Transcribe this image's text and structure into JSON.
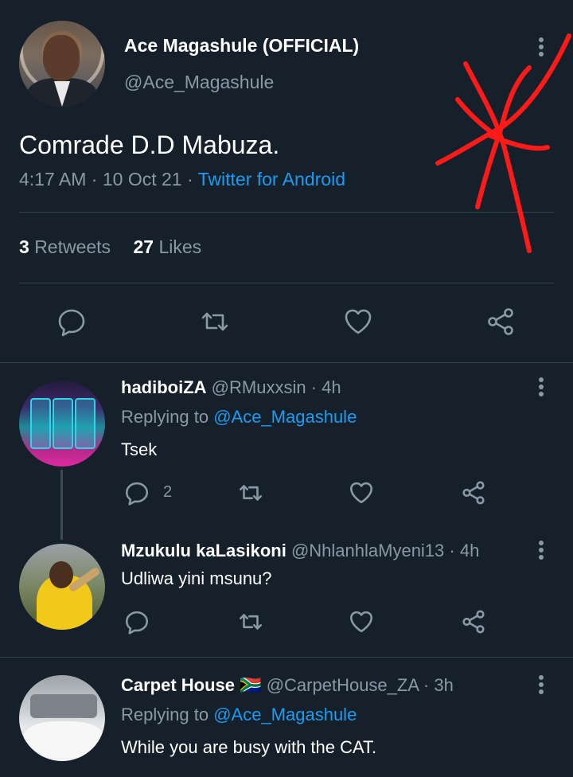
{
  "main_tweet": {
    "display_name": "Ace Magashule (OFFICIAL)",
    "handle": "@Ace_Magashule",
    "text": "Comrade D.D Mabuza.",
    "time": "4:17 AM",
    "date": "10 Oct 21",
    "source": "Twitter for Android",
    "retweets_count": "3",
    "retweets_label": "Retweets",
    "likes_count": "27",
    "likes_label": "Likes"
  },
  "replies": [
    {
      "display_name": "hadiboiZA",
      "handle": "@RMuxxsin",
      "age": "4h",
      "replying_prefix": "Replying to",
      "replying_to": "@Ace_Magashule",
      "text": "Tsek",
      "reply_count": "2"
    },
    {
      "display_name": "Mzukulu kaLasikoni",
      "handle": "@NhlanhlaMyeni13",
      "age": "4h",
      "text": "Udliwa yini msunu?"
    },
    {
      "display_name": "Carpet House",
      "flag": "🇿🇦",
      "handle": "@CarpetHouse_ZA",
      "age": "3h",
      "replying_prefix": "Replying to",
      "replying_to": "@Ace_Magashule",
      "text": "While you are busy with the CAT."
    }
  ],
  "separator": "·",
  "colors": {
    "background": "#15202b",
    "text": "#ffffff",
    "muted": "#8b98a5",
    "link": "#1d9bf0",
    "divider": "#38444d",
    "scribble": "#ff1a1a"
  },
  "icons": [
    "more-vertical-icon",
    "reply-icon",
    "retweet-icon",
    "like-icon",
    "share-icon"
  ]
}
